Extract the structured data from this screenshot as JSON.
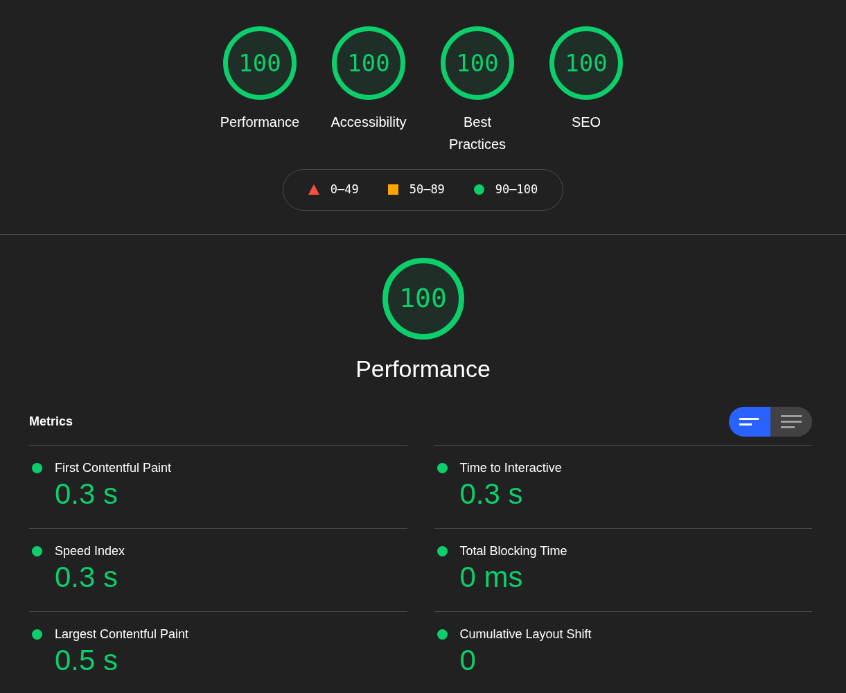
{
  "gauges": [
    {
      "score": "100",
      "label": "Performance",
      "level": 1,
      "kind": "pass"
    },
    {
      "score": "100",
      "label": "Accessibility",
      "level": 1,
      "kind": "pass"
    },
    {
      "score": "100",
      "label": "Best Practices",
      "level": 1,
      "kind": "pass"
    },
    {
      "score": "100",
      "label": "SEO",
      "level": 1,
      "kind": "pass"
    }
  ],
  "legend": [
    {
      "kind": "fail",
      "range": "0–49"
    },
    {
      "kind": "average",
      "range": "50–89"
    },
    {
      "kind": "pass",
      "range": "90–100"
    }
  ],
  "category": {
    "score": "100",
    "title": "Performance",
    "level": 1,
    "kind": "pass"
  },
  "metrics_header": "Metrics",
  "view_toggle": [
    {
      "kind": "summary",
      "selected": true
    },
    {
      "kind": "list",
      "selected": false
    }
  ],
  "metrics": [
    {
      "title": "First Contentful Paint",
      "value": "0.3 s",
      "kind": "pass"
    },
    {
      "title": "Time to Interactive",
      "value": "0.3 s",
      "kind": "pass"
    },
    {
      "title": "Speed Index",
      "value": "0.3 s",
      "kind": "pass"
    },
    {
      "title": "Total Blocking Time",
      "value": "0 ms",
      "kind": "pass"
    },
    {
      "title": "Largest Contentful Paint",
      "value": "0.5 s",
      "kind": "pass"
    },
    {
      "title": "Cumulative Layout Shift",
      "value": "0",
      "kind": "pass"
    }
  ]
}
